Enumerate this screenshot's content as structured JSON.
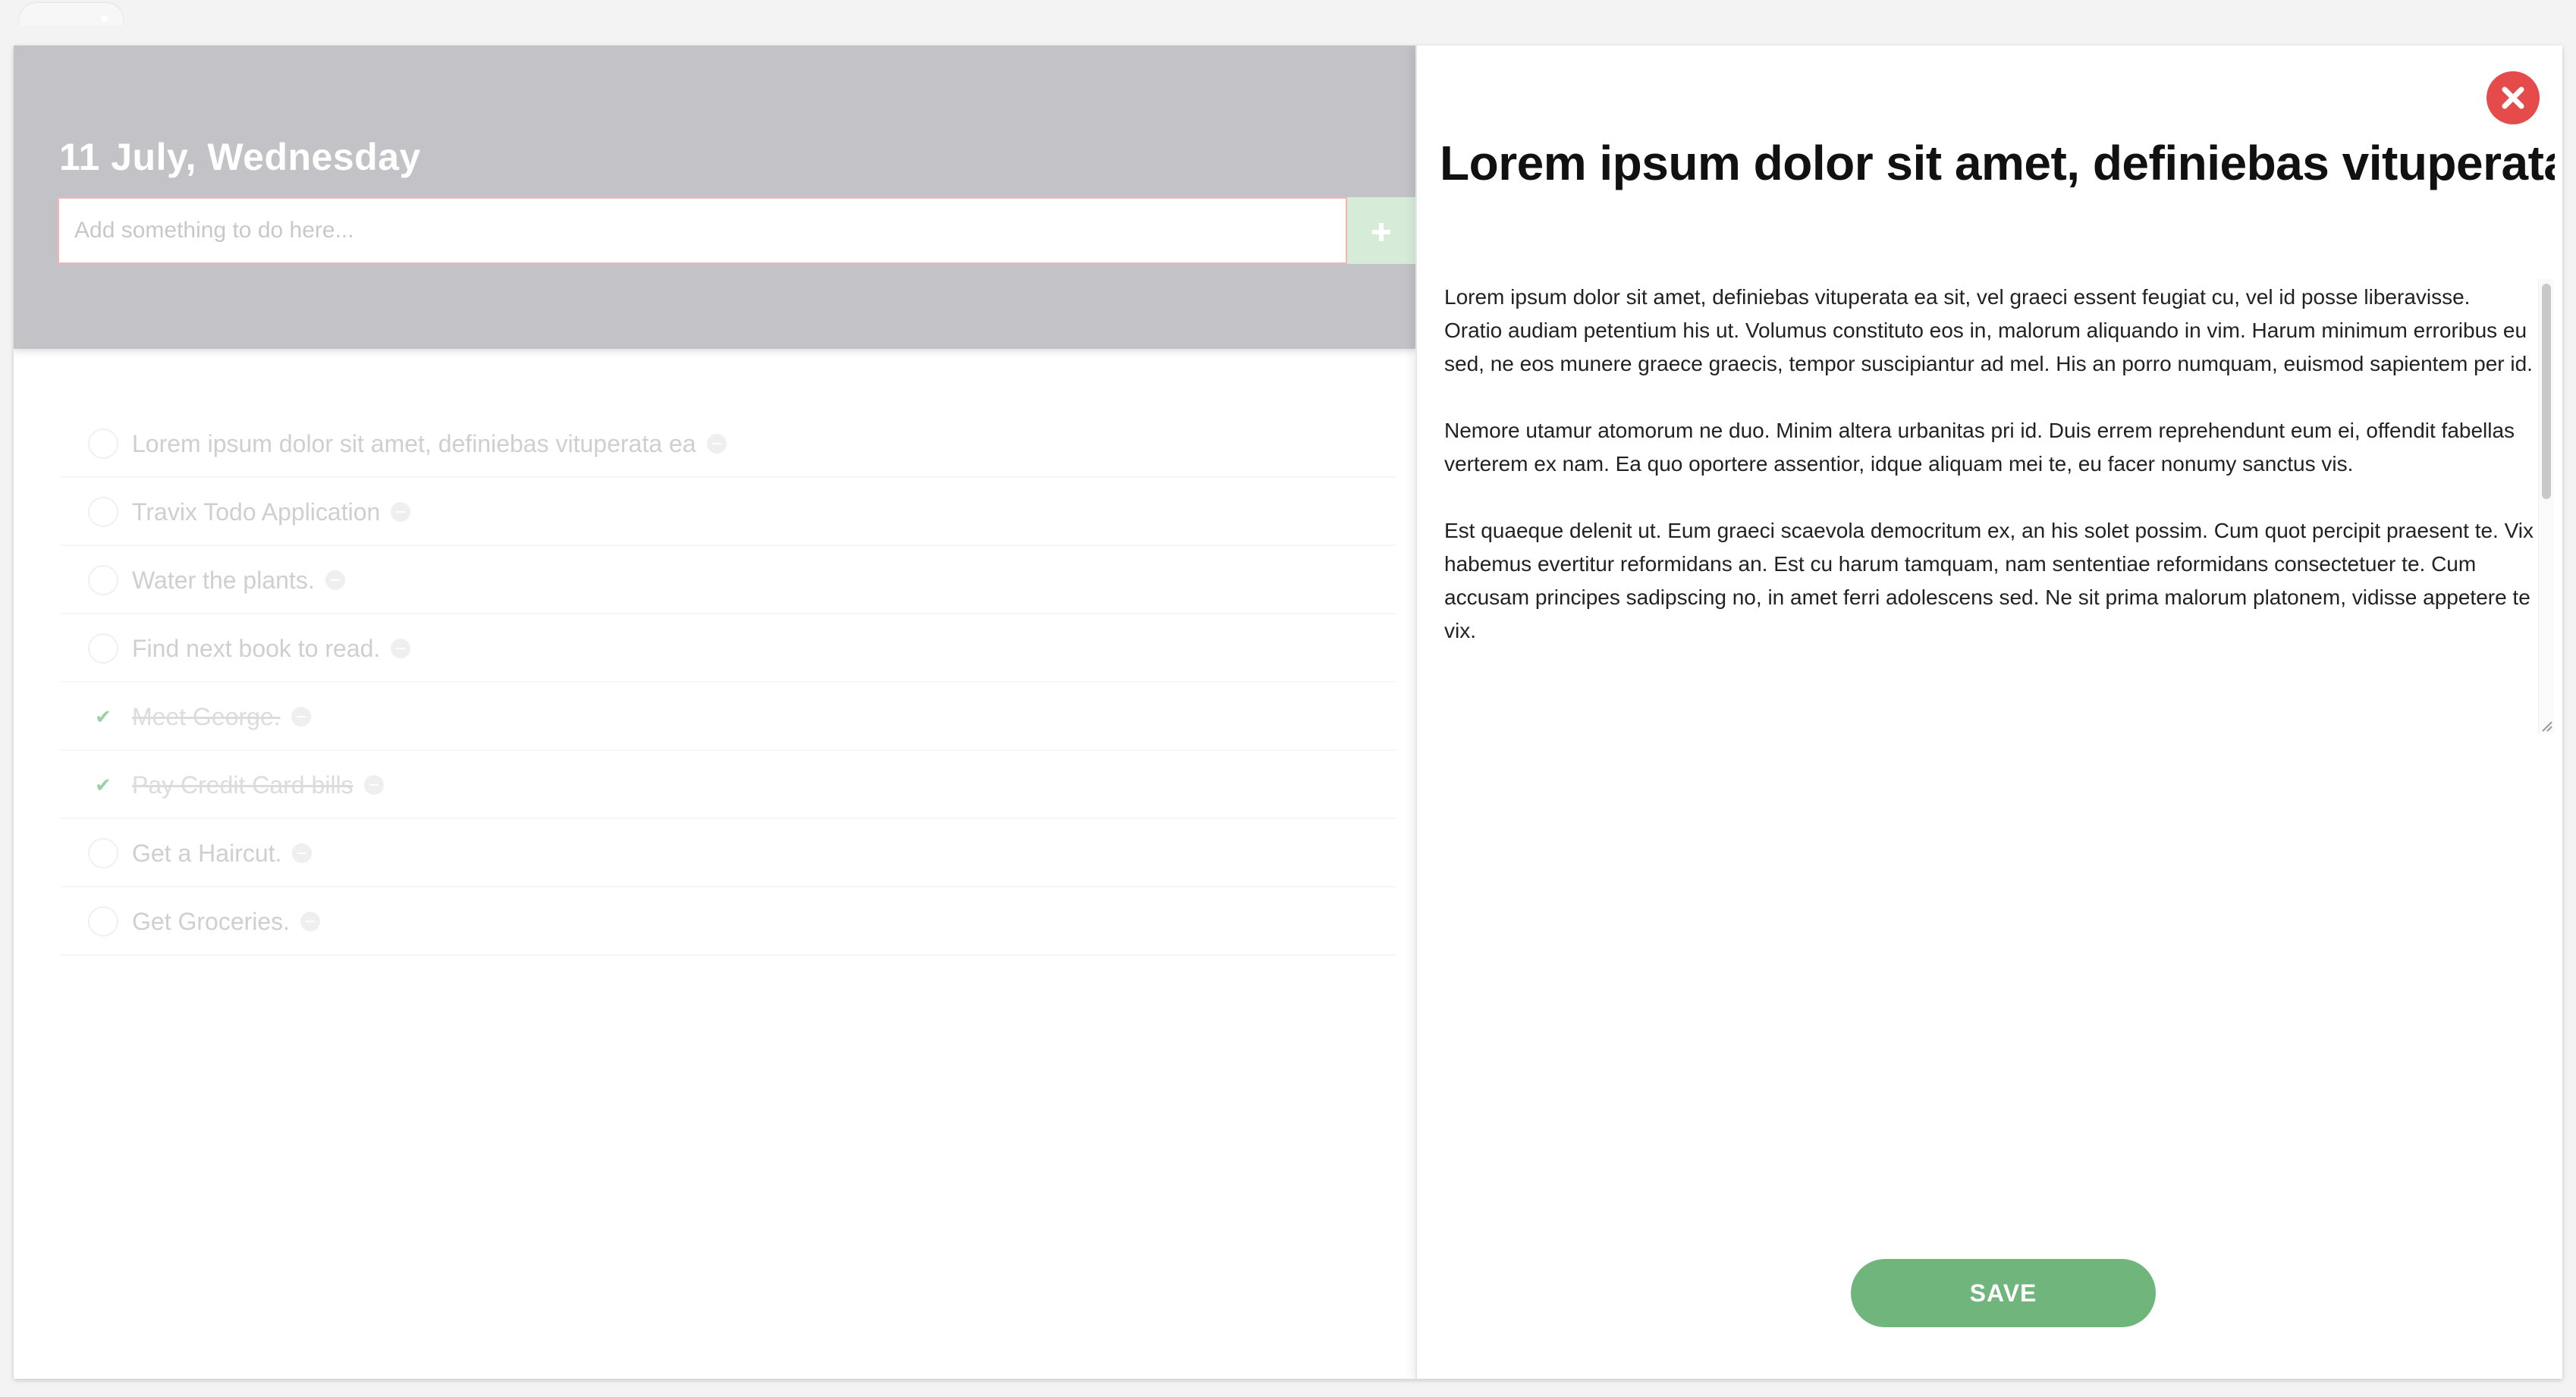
{
  "todo": {
    "date": "11 July, Wednesday",
    "input_placeholder": "Add something to do here...",
    "add_icon": "plus-icon",
    "items": [
      {
        "label": "Lorem ipsum dolor sit amet, definiebas vituperata ea",
        "done": false
      },
      {
        "label": "Travix Todo Application",
        "done": false
      },
      {
        "label": "Water the plants.",
        "done": false
      },
      {
        "label": "Find next book to read.",
        "done": false
      },
      {
        "label": "Meet George.",
        "done": true
      },
      {
        "label": "Pay Credit Card bills",
        "done": true
      },
      {
        "label": "Get a Haircut.",
        "done": false
      },
      {
        "label": "Get Groceries.",
        "done": false
      }
    ]
  },
  "detail": {
    "close_icon": "close-icon",
    "title": "Lorem ipsum dolor sit amet, definiebas vituperata ea",
    "body": "Lorem ipsum dolor sit amet, definiebas vituperata ea sit, vel graeci essent feugiat cu, vel id posse liberavisse. Oratio audiam petentium his ut. Volumus constituto eos in, malorum aliquando in vim. Harum minimum erroribus eu sed, ne eos munere graece graecis, tempor suscipiantur ad mel. His an porro numquam, euismod sapientem per id.\n\nNemore utamur atomorum ne duo. Minim altera urbanitas pri id. Duis errem reprehendunt eum ei, offendit fabellas verterem ex nam. Ea quo oportere assentior, idque aliquam mei te, eu facer nonumy sanctus vis.\n\nEst quaeque delenit ut. Eum graeci scaevola democritum ex, an his solet possim. Cum quot percipit praesent te. Vix habemus evertitur reformidans an. Est cu harum tamquam, nam sententiae reformidans consectetuer te. Cum accusam principes sadipscing no, in amet ferri adolescens sed. Ne sit prima malorum platonem, vidisse appetere te vix.",
    "save_label": "SAVE"
  },
  "colors": {
    "header_overlay": "#c3c2c6",
    "add_button": "#d6ecd9",
    "close_button": "#e64b4b",
    "save_button": "#70b57c",
    "check_mark": "#9ad2a5"
  }
}
